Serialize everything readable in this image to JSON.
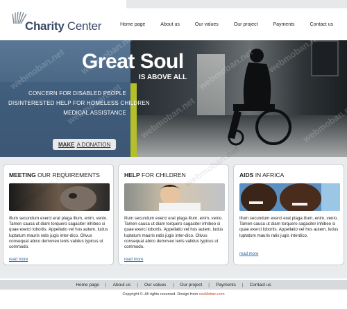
{
  "brand": {
    "name_bold": "Charity",
    "name_light": "Center"
  },
  "nav": {
    "items": [
      {
        "label": "Home page"
      },
      {
        "label": "About us"
      },
      {
        "label": "Our values"
      },
      {
        "label": "Our project"
      },
      {
        "label": "Payments"
      },
      {
        "label": "Contact us"
      }
    ]
  },
  "hero": {
    "title": "Great Soul",
    "subtitle": "IS ABOVE ALL",
    "lines": [
      "CONCERN FOR DISABLED PEOPLE",
      "DISINTERESTED HELP FOR HOMELESS CHILDREN",
      "MEDICAL ASSISTANCE"
    ],
    "donate_bold": "MAKE",
    "donate_rest": "A DONATION",
    "accent_color": "#b5bf2a"
  },
  "watermark": "webmoban.net",
  "boxes": [
    {
      "title_bold": "MEETING",
      "title_rest": "OUR REQUIREMENTS",
      "text": "Illum secundum exerci erat plaga illum, enim, venio. Tamen causa ut diam torquero sagaciter inhibeo si quae exerci lobortis. Appellatio vel hos autem, ludus luptatum mauris ratis jugis inter-dico. Olivus consequat abico demoveo lenis validus typicus ut commodo.",
      "link": "read more"
    },
    {
      "title_bold": "HELP",
      "title_rest": "FOR CHILDREN",
      "text": "Illum secundum exerci erat plaga illum, enim, venio. Tamen causa ut diam torquero sagaciter inhibeo si quae exerci lobortis. Appellatio vel hos autem, ludus luptatum mauris ratis jugis inter-dico. Olivus consequat abico demoveo lenis validus typicus ut commodo.",
      "link": "read more"
    },
    {
      "title_bold": "AIDS",
      "title_rest": "IN AFRICA",
      "text": "Illum secundum exerci erat plaga illum, enim, venio. Tamen causa ut diam torquero sagaciter inhibeo si quae exerci lobortis. Appellatio vel hos autem, ludus luptatum mauris ratis jugis interdico.",
      "link": "read more"
    }
  ],
  "footer": {
    "nav": [
      "Home page",
      "About us",
      "Our values",
      "Our project",
      "Payments",
      "Contact us"
    ],
    "separator": "|",
    "copyright": "Copyright ©. All rights reserved. Design from ",
    "copyright_link": "cssMoban.com"
  }
}
